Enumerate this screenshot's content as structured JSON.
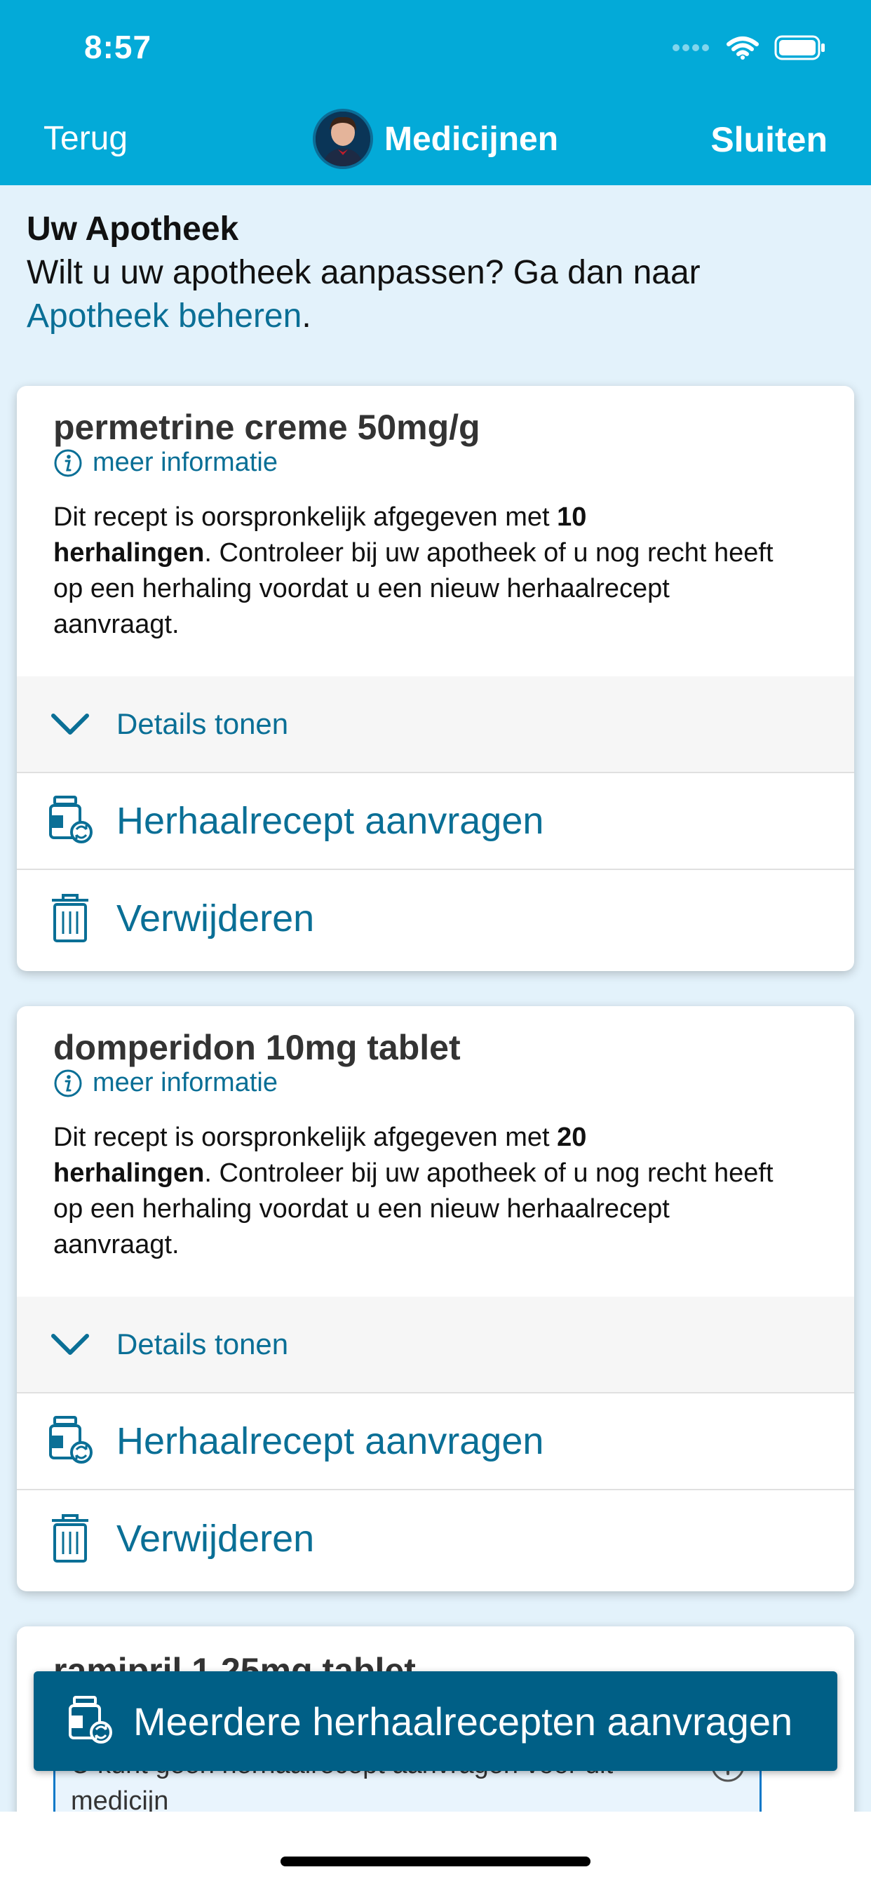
{
  "status_bar": {
    "time": "8:57"
  },
  "nav": {
    "back_label": "Terug",
    "title": "Medicijnen",
    "close_label": "Sluiten"
  },
  "intro": {
    "heading": "Uw Apotheek",
    "text": "Wilt u uw apotheek aanpassen? Ga dan naar",
    "link": "Apotheek beheren",
    "suffix": "."
  },
  "medicines": [
    {
      "name": "permetrine creme 50mg/g",
      "info_label": "meer informatie",
      "desc_prefix": "Dit recept is oorspronkelijk afgegeven met ",
      "desc_count": "10",
      "desc_bold_word": "herhalingen",
      "desc_suffix": ". Controleer bij uw apotheek of u nog recht heeft op een herhaling voordat u een nieuw herhaalrecept aanvraagt.",
      "details_label": "Details tonen",
      "refill_label": "Herhaalrecept aanvragen",
      "delete_label": "Verwijderen"
    },
    {
      "name": "domperidon 10mg tablet",
      "info_label": "meer informatie",
      "desc_prefix": "Dit recept is oorspronkelijk afgegeven met ",
      "desc_count": "20",
      "desc_bold_word": "herhalingen",
      "desc_suffix": ". Controleer bij uw apotheek of u nog recht heeft op een herhaling voordat u een nieuw herhaalrecept aanvraagt.",
      "details_label": "Details tonen",
      "refill_label": "Herhaalrecept aanvragen",
      "delete_label": "Verwijderen"
    },
    {
      "name": "ramipril 1,25mg tablet",
      "warning": "U kunt geen herhaalrecept aanvragen voor dit medicijn"
    }
  ],
  "bottom_button": {
    "label": "Meerdere herhaalrecepten aanvragen"
  },
  "colors": {
    "header": "#03aad8",
    "accent": "#0a6f96",
    "button": "#005f86",
    "background": "#e3f2fb"
  },
  "icons": {
    "info": "info-icon",
    "details": "chevron-down-icon",
    "refill": "medicine-refill-icon",
    "delete": "trash-icon",
    "warning": "info-icon"
  }
}
